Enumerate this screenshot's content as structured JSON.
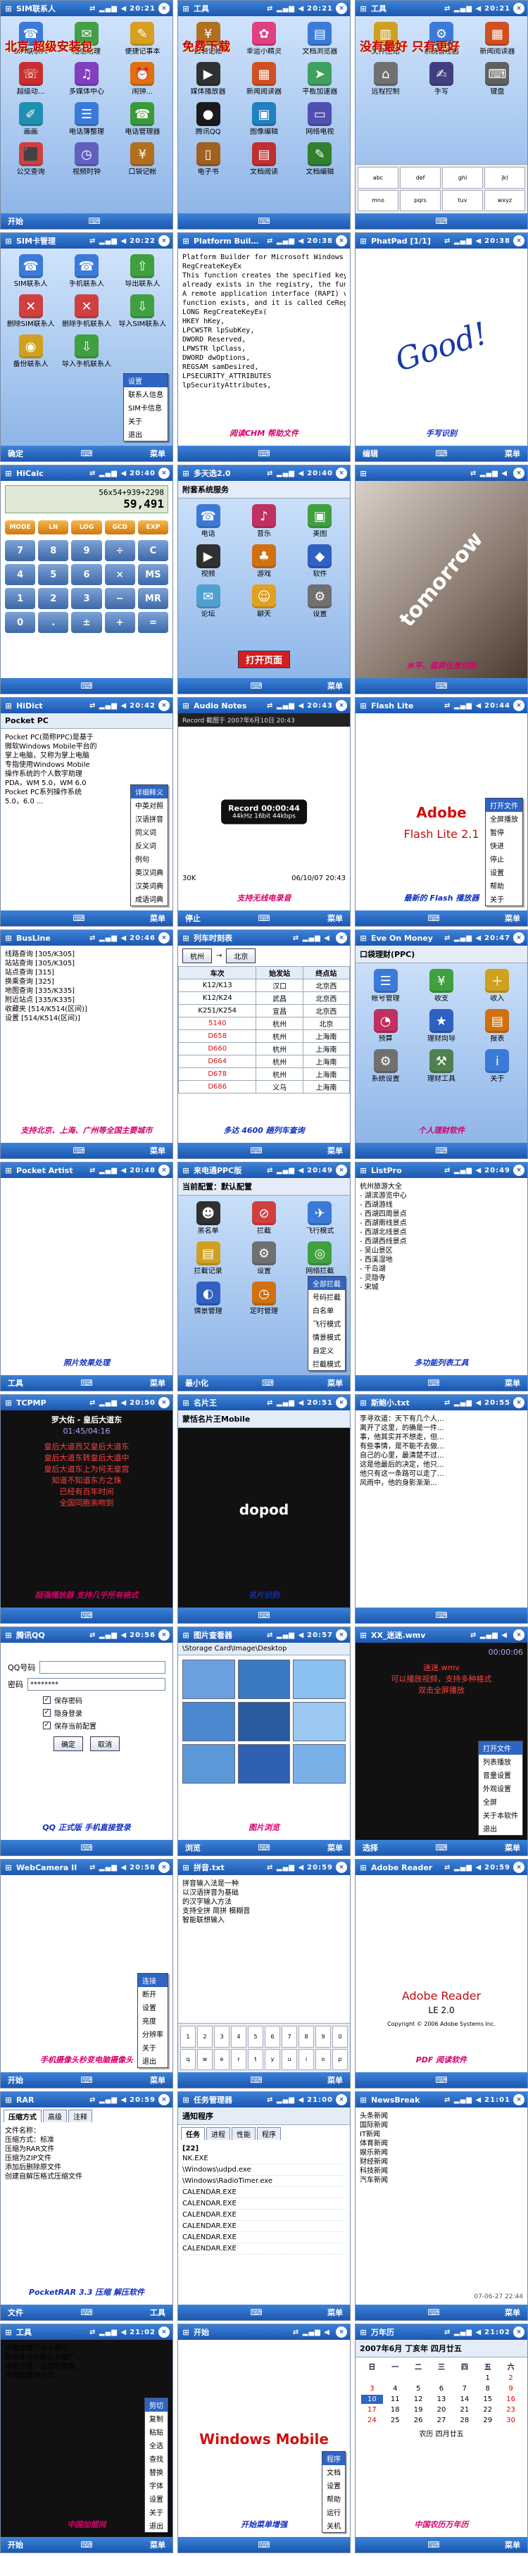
{
  "colors": {
    "titlebar_top": "#3d82d8",
    "titlebar_bottom": "#1c57b0",
    "accent_red": "#c40010",
    "accent_pink": "#d6006b",
    "selection_blue": "#2f64c2"
  },
  "screens": [
    {
      "title": "SIM联系人",
      "time": "20:21",
      "banner": "北京 超级安装包",
      "icons": [
        {
          "label": "SIM联系人",
          "icon": "contacts-icon",
          "color": "#3b7ad8"
        },
        {
          "label": "短信助理",
          "icon": "sms-icon",
          "color": "#44a044"
        },
        {
          "label": "便捷记事本",
          "icon": "note-icon",
          "color": "#d8a020"
        },
        {
          "label": "超级动...",
          "icon": "dial-icon",
          "color": "#c83030"
        },
        {
          "label": "多媒体中心",
          "icon": "media-icon",
          "color": "#8040c0"
        },
        {
          "label": "闹钟...",
          "icon": "alarm-icon",
          "color": "#e07010"
        },
        {
          "label": "画画",
          "icon": "paint-icon",
          "color": "#2090b0"
        },
        {
          "label": "电话簿整理",
          "icon": "phonebook-icon",
          "color": "#3b7ad8"
        },
        {
          "label": "电话管理器",
          "icon": "phone-icon",
          "color": "#3a9a3a"
        },
        {
          "label": "公交查询",
          "icon": "bus-icon",
          "color": "#d04040"
        },
        {
          "label": "视频时钟",
          "icon": "clock-icon",
          "color": "#6060c0"
        },
        {
          "label": "口袋记帐",
          "icon": "wallet-icon",
          "color": "#b07020"
        }
      ],
      "menu_left": "开始",
      "menu_right": ""
    },
    {
      "title": "工具",
      "time": "20:21",
      "banner": "免费下载",
      "icons": [
        {
          "label": "口袋记帐",
          "icon": "wallet-icon",
          "color": "#b07020"
        },
        {
          "label": "幸运小精灵",
          "icon": "luck-icon",
          "color": "#e04080"
        },
        {
          "label": "文档浏览器",
          "icon": "doc-icon",
          "color": "#3b7ad8"
        },
        {
          "label": "媒体播放器",
          "icon": "player-icon",
          "color": "#303030"
        },
        {
          "label": "新闻阅读器",
          "icon": "news-icon",
          "color": "#d05020"
        },
        {
          "label": "平板加速器",
          "icon": "speed-icon",
          "color": "#40a060"
        },
        {
          "label": "腾讯QQ",
          "icon": "qq-icon",
          "color": "#1a1a1a"
        },
        {
          "label": "图像编辑",
          "icon": "image-icon",
          "color": "#2080c0"
        },
        {
          "label": "网络电视",
          "icon": "tv-icon",
          "color": "#5050b0"
        },
        {
          "label": "电子书",
          "icon": "book-icon",
          "color": "#a06020"
        },
        {
          "label": "文档阅读",
          "icon": "reader-icon",
          "color": "#c03030"
        },
        {
          "label": "文档编辑",
          "icon": "edit-icon",
          "color": "#308030"
        }
      ],
      "menu_left": "",
      "menu_right": ""
    },
    {
      "title": "工具",
      "time": "20:21",
      "banner": "没有最好 只有更好",
      "icons": [
        {
          "label": "文件压缩",
          "icon": "zip-icon",
          "color": "#d0a020"
        },
        {
          "label": "系统管理器",
          "icon": "system-icon",
          "color": "#3b7ad8"
        },
        {
          "label": "新闻阅读器",
          "icon": "news-icon",
          "color": "#d05020"
        },
        {
          "label": "远程控制",
          "icon": "remote-icon",
          "color": "#707070"
        },
        {
          "label": "手写",
          "icon": "pen-icon",
          "color": "#404080"
        },
        {
          "label": "键盘",
          "icon": "keyboard-icon",
          "color": "#606060"
        }
      ],
      "keys": [
        "abc",
        "def",
        "ghi",
        "jkl",
        "mno",
        "pqrs",
        "tuv",
        "wxyz"
      ],
      "menu_left": "",
      "menu_right": ""
    },
    {
      "title": "SIM卡管理",
      "time": "20:22",
      "icons": [
        {
          "label": "SIM联系人",
          "icon": "contacts-icon",
          "color": "#3b7ad8"
        },
        {
          "label": "手机联系人",
          "icon": "contacts-icon",
          "color": "#3b7ad8"
        },
        {
          "label": "导出联系人",
          "icon": "export-icon",
          "color": "#40a040"
        },
        {
          "label": "删除SIM联系人",
          "icon": "delete-icon",
          "color": "#d04040"
        },
        {
          "label": "删除手机联系人",
          "icon": "delete-icon",
          "color": "#d04040"
        },
        {
          "label": "导入SIM联系人",
          "icon": "import-icon",
          "color": "#40a040"
        },
        {
          "label": "备份联系人",
          "icon": "backup-icon",
          "color": "#d0a020"
        },
        {
          "label": "导入手机联系人",
          "icon": "import-icon",
          "color": "#40a040"
        }
      ],
      "popup": [
        "设置",
        "联系人信息",
        "SIM卡信息",
        "关于",
        "退出"
      ],
      "menu_left": "确定",
      "menu_right": "菜单"
    },
    {
      "title": "Platform Builder",
      "time": "20:38",
      "banner": "Platform Builder for Microsoft Windows CE 5.0",
      "lines": [
        "Platform Builder for Microsoft Windows CE 5.0",
        "RegCreateKeyEx",
        "This function creates the specified key. If the key",
        "already exists in the registry, the function opens it.",
        "A remote application interface (RAPI) version of this",
        "function exists, and it is called CeRegCreateKeyEx.",
        "LONG RegCreateKeyEx(",
        "  HKEY hKey,",
        "  LPCWSTR lpSubKey,",
        "  DWORD Reserved,",
        "  LPWSTR lpClass,",
        "  DWORD dwOptions,",
        "  REGSAM samDesired,",
        "  LPSECURITY_ATTRIBUTES",
        "  lpSecurityAttributes,"
      ],
      "caption": "阅读CHM 帮助文件",
      "menu_left": "",
      "menu_right": ""
    },
    {
      "title": "PhatPad [1/1]",
      "time": "20:38",
      "handwriting": "Good!",
      "caption": "手写识别",
      "menu_left": "编辑",
      "menu_right": "菜单"
    },
    {
      "title": "HiCalc",
      "time": "20:40",
      "expression": "56x54+939+2298",
      "result": "59,491",
      "func_keys": [
        "MODE",
        "LN",
        "LOG",
        "GCD",
        "EXP"
      ],
      "keys": [
        "7",
        "8",
        "9",
        "÷",
        "C",
        "4",
        "5",
        "6",
        "×",
        "MS",
        "1",
        "2",
        "3",
        "−",
        "MR",
        "0",
        ".",
        "±",
        "+",
        "="
      ],
      "menu_left": "",
      "menu_right": ""
    },
    {
      "title": "多天选2.0",
      "time": "20:40",
      "header": "附套系统服务",
      "icons": [
        {
          "label": "电话",
          "icon": "phone-icon",
          "color": "#3b7ad8"
        },
        {
          "label": "音乐",
          "icon": "music-icon",
          "color": "#c03060"
        },
        {
          "label": "美图",
          "icon": "photo-icon",
          "color": "#40a040"
        },
        {
          "label": "视频",
          "icon": "video-icon",
          "color": "#303030"
        },
        {
          "label": "游戏",
          "icon": "game-icon",
          "color": "#d07010"
        },
        {
          "label": "软件",
          "icon": "software-icon",
          "color": "#3060c0"
        },
        {
          "label": "论坛",
          "icon": "forum-icon",
          "color": "#50a0d0"
        },
        {
          "label": "聊天",
          "icon": "chat-icon",
          "color": "#e0a020"
        },
        {
          "label": "设置",
          "icon": "settings-icon",
          "color": "#707070"
        }
      ],
      "button": "打开页面",
      "menu_left": "",
      "menu_right": "菜单"
    },
    {
      "title": "",
      "time": "",
      "photo_text": "tomorrow",
      "caption": "水平、竖屏任意切换",
      "menu_left": "",
      "menu_right": ""
    },
    {
      "title": "HiDict",
      "time": "20:42",
      "header": "Pocket PC",
      "lines": [
        "Pocket PC(简称PPC)是基于",
        "微软Windows Mobile平台的",
        "掌上电脑，又称为掌上电脑",
        "专指使用Windows Mobile",
        "操作系统的个人数字助理",
        "PDA，WM 5.0，WM 6.0",
        "Pocket PC系列操作系统",
        "5.0，6.0 ..."
      ],
      "popup": [
        "详细释义",
        "中英对照",
        "汉语拼音",
        "同义词",
        "反义词",
        "例句",
        "英汉词典",
        "汉英词典",
        "成语词典"
      ],
      "menu_left": "",
      "menu_right": "菜单"
    },
    {
      "title": "Audio Notes",
      "time": "20:43",
      "status": "Record 截图于 2007年6月10日 20:43",
      "caption": "支持无线电录音",
      "record_text": "Record 00:00:44",
      "format_text": "44kHz 16bit 44kbps",
      "footer_left": "30K",
      "footer_right": "06/10/07 20:43",
      "menu_left": "停止",
      "menu_right": "菜单"
    },
    {
      "title": "Flash Lite",
      "time": "20:44",
      "caption": "最新的 Flash 播放器",
      "brand": "Adobe",
      "product": "Flash Lite 2.1",
      "popup": [
        "打开文件",
        "全屏播放",
        "暂停",
        "快进",
        "停止",
        "设置",
        "帮助",
        "关于"
      ],
      "menu_left": "",
      "menu_right": "菜单"
    },
    {
      "title": "BusLine",
      "time": "20:46",
      "lines": [
        "线路查询 [305/K305]",
        "站站查询 [305/K305]",
        "站点查询 [315]",
        "换乘查询 [325]",
        "地图查询 [335/K335]",
        "附近站点 [335/K335]",
        "收藏夹 [514/K514(区间)]",
        "设置 [514/K514(区间)]"
      ],
      "caption": "支持北京、上海、广州等全国主要城市",
      "menu_left": "",
      "menu_right": "菜单"
    },
    {
      "title": "列车时刻表",
      "time": "",
      "from": "杭州",
      "to": "北京",
      "columns": [
        "车次",
        "始发站",
        "终点站"
      ],
      "rows": [
        [
          "K12/K13",
          "汉口",
          "北京西"
        ],
        [
          "K12/K24",
          "武昌",
          "北京西"
        ],
        [
          "K251/K254",
          "宣昌",
          "北京西"
        ],
        [
          "5140",
          "杭州",
          "北京"
        ],
        [
          "D658",
          "杭州",
          "上海南"
        ],
        [
          "D660",
          "杭州",
          "上海南"
        ],
        [
          "D664",
          "杭州",
          "上海南"
        ],
        [
          "D678",
          "杭州",
          "上海南"
        ],
        [
          "D686",
          "义乌",
          "上海南"
        ]
      ],
      "caption": "多达 4600 趟列车查询",
      "menu_left": "",
      "menu_right": "菜单"
    },
    {
      "title": "Eve On Money",
      "time": "20:47",
      "header": "口袋理财(PPC)",
      "icons": [
        {
          "label": "帐号管理",
          "icon": "account-icon",
          "color": "#3b7ad8"
        },
        {
          "label": "收支",
          "icon": "money-icon",
          "color": "#40a040"
        },
        {
          "label": "收入",
          "icon": "income-icon",
          "color": "#d0a020"
        },
        {
          "label": "预算",
          "icon": "budget-icon",
          "color": "#c03060"
        },
        {
          "label": "理财向导",
          "icon": "guide-icon",
          "color": "#3060c0"
        },
        {
          "label": "报表",
          "icon": "report-icon",
          "color": "#d07010"
        },
        {
          "label": "系统设置",
          "icon": "settings-icon",
          "color": "#707070"
        },
        {
          "label": "理财工具",
          "icon": "tools-icon",
          "color": "#508050"
        },
        {
          "label": "关于",
          "icon": "info-icon",
          "color": "#3b7ad8"
        }
      ],
      "caption": "个人理财软件",
      "menu_left": "",
      "menu_right": ""
    },
    {
      "title": "Pocket Artist",
      "time": "20:48",
      "caption": "照片效果处理",
      "menu_left": "工具",
      "menu_right": "菜单"
    },
    {
      "title": "来电通PPC版",
      "time": "20:49",
      "header": "当前配置：默认配置",
      "icons": [
        {
          "label": "黑名单",
          "icon": "blacklist-icon",
          "color": "#303030"
        },
        {
          "label": "拦截",
          "icon": "block-icon",
          "color": "#d04040"
        },
        {
          "label": "飞行模式",
          "icon": "plane-icon",
          "color": "#3b7ad8"
        },
        {
          "label": "拦截记录",
          "icon": "log-icon",
          "color": "#d0a020"
        },
        {
          "label": "设置",
          "icon": "settings-icon",
          "color": "#707070"
        },
        {
          "label": "网络拦截",
          "icon": "network-icon",
          "color": "#40a040"
        },
        {
          "label": "情景管理",
          "icon": "scene-icon",
          "color": "#3060c0"
        },
        {
          "label": "定时管理",
          "icon": "timer-icon",
          "color": "#d07010"
        },
        {
          "label": "数据库",
          "icon": "database-icon",
          "color": "#8040c0"
        }
      ],
      "popup": [
        "全部拦截",
        "号码拦截",
        "白名单",
        "飞行模式",
        "情景模式",
        "自定义",
        "拦截模式"
      ],
      "menu_left": "最小化",
      "menu_right": "菜单"
    },
    {
      "title": "ListPro",
      "time": "20:49",
      "lines": [
        "杭州旅游大全",
        "- 湖滨游览中心",
        "- 西湖游线",
        "- 西湖四周景点",
        "- 西湖南线景点",
        "- 西湖北线景点",
        "- 西湖西线景点",
        "- 吴山景区",
        "- 西溪湿地",
        "- 千岛湖",
        "- 灵隐寺",
        "- 宋城"
      ],
      "caption": "多功能列表工具",
      "menu_left": "",
      "menu_right": "菜单"
    },
    {
      "title": "TCPMP",
      "time": "20:50",
      "song": "罗大佑 - 皇后大道东",
      "duration": "01:45/04:16",
      "lyrics": [
        "皇后大道西又皇后大道东",
        "皇后大道东转皇后大道中",
        "皇后大道东上为何无皇宫",
        "知道不知道东方之珠",
        "已经有百年时间",
        "全国同胞亲吻到"
      ],
      "caption": "超强播放器 支持几乎所有格式",
      "menu_left": "",
      "menu_right": ""
    },
    {
      "title": "名片王",
      "time": "20:51",
      "header": "蒙恬名片王Mobile",
      "caption": "名片识别",
      "brand": "dopod",
      "menu_left": "",
      "menu_right": ""
    },
    {
      "title": "斯鲍小.txt",
      "time": "20:55",
      "lines": [
        "李寻欢道：天下有几个人...",
        "离开了这里，的确是一件...",
        "事，他其实并不想走，但...",
        "有些事情，是不能不去做...",
        "自己的心里，最清楚不过...",
        "这是他最后的决定，他只...",
        "他只有这一条路可以走了...",
        "风雨中，他的身影渐渐..."
      ],
      "status": "27%  斯鲍小.txt  2007/6/9 19:29:1%  20:55",
      "menu_left": "",
      "menu_right": ""
    },
    {
      "title": "腾讯QQ",
      "time": "20:56",
      "qq_label": "QQ号码",
      "qq_value": "",
      "password_label": "密码",
      "password_value": "********",
      "checks": [
        {
          "label": "保存密码",
          "checked": true
        },
        {
          "label": "隐身登录",
          "checked": true
        },
        {
          "label": "保存当前配置",
          "checked": true
        }
      ],
      "ok_label": "确定",
      "cancel_label": "取消",
      "caption": "QQ 正式版 手机直接登录",
      "menu_left": "",
      "menu_right": ""
    },
    {
      "title": "图片查看器",
      "time": "20:57",
      "path": "\\Storage Card\\Image\\Desktop",
      "caption": "图片浏览",
      "menu_left": "浏览",
      "menu_right": "菜单"
    },
    {
      "title": "XX_迷迷.wmv",
      "time": "",
      "duration": "00:00:06",
      "lyrics": [
        "迷迷.wmv",
        "可以播放视频，支持多种格式",
        "双击全屏播放"
      ],
      "popup": [
        "打开文件",
        "列表播放",
        "音量设置",
        "外观设置",
        "全屏",
        "关于本软件",
        "退出"
      ],
      "menu_left": "选择",
      "menu_right": "菜单"
    },
    {
      "title": "WebCamera II",
      "time": "20:58",
      "caption": "手机摄像头秒变电脑摄像头",
      "popup": [
        "连接",
        "断开",
        "设置",
        "亮度",
        "分辨率",
        "关于",
        "退出"
      ],
      "menu_left": "开始",
      "menu_right": "菜单"
    },
    {
      "title": "拼音.txt",
      "time": "20:59",
      "lines": [
        "拼音输入法是一种",
        "以汉语拼音为基础",
        "的汉字输入方法",
        "支持全拼 简拼 模糊音",
        "智能联想输入"
      ],
      "keys": [
        "1",
        "2",
        "3",
        "4",
        "5",
        "6",
        "7",
        "8",
        "9",
        "0",
        "q",
        "w",
        "e",
        "r",
        "t",
        "y",
        "u",
        "i",
        "o",
        "p"
      ],
      "menu_left": "",
      "menu_right": "菜单"
    },
    {
      "title": "Adobe Reader",
      "time": "20:59",
      "caption": "PDF 阅读软件",
      "product": "Adobe Reader",
      "version": "LE 2.0",
      "copyright": "Copyright © 2006 Adobe Systems Inc.",
      "menu_left": "",
      "menu_right": ""
    },
    {
      "title": "RAR",
      "time": "20:59",
      "tabs": [
        "压缩方式",
        "高级",
        "注释"
      ],
      "lines": [
        "文件名称：",
        "压缩方式：标准",
        "压缩为RAR文件",
        "压缩为ZIP文件",
        "添加后删除原文件",
        "创建自解压格式压缩文件"
      ],
      "caption": "PocketRAR 3.3 压缩 解压软件",
      "menu_left": "文件",
      "menu_right": "工具"
    },
    {
      "title": "任务管理器",
      "time": "21:00",
      "tabs": [
        "任务",
        "进程",
        "性能",
        "程序"
      ],
      "header": "通知程序",
      "count": "[22]",
      "processes": [
        "NK.EXE",
        "\\Windows\\udpd.exe",
        "\\Windows\\RadioTimer.exe",
        "CALENDAR.EXE",
        "CALENDAR.EXE",
        "CALENDAR.EXE",
        "CALENDAR.EXE",
        "CALENDAR.EXE",
        "CALENDAR.EXE"
      ],
      "menu_left": "",
      "menu_right": "菜单"
    },
    {
      "title": "NewsBreak",
      "time": "21:01",
      "lines": [
        "头条新闻",
        "国际新闻",
        "IT新闻",
        "体育新闻",
        "娱乐新闻",
        "财经新闻",
        "科技新闻",
        "汽车新闻"
      ],
      "date": "07-06-27 22:44",
      "menu_left": "",
      "menu_right": "菜单"
    },
    {
      "title": "工具",
      "time": "21:02",
      "lines": [
        "中国加盟行业大都与...",
        "提供多元化的企业推广...",
        "商机无限，让您的财富...",
        "中国加盟网为您..."
      ],
      "popup": [
        "剪切",
        "复制",
        "粘贴",
        "全选",
        "查找",
        "替换",
        "字体",
        "设置",
        "关于",
        "退出"
      ],
      "caption": "中国加盟网",
      "menu_left": "开始",
      "menu_right": "菜单"
    },
    {
      "title": "开始",
      "time": "",
      "popup": [
        "程序",
        "文档",
        "设置",
        "帮助",
        "运行",
        "关机"
      ],
      "brand": "Windows Mobile",
      "edition": "Enterprise Edition",
      "caption": "开始菜单增强",
      "menu_left": "",
      "menu_right": ""
    },
    {
      "title": "万年历",
      "time": "21:02",
      "header": "2007年6月 丁亥年 四月廿五",
      "subheader": "农历 四月廿五",
      "days_header": [
        "日",
        "一",
        "二",
        "三",
        "四",
        "五",
        "六"
      ],
      "days": [
        "",
        "",
        "",
        "",
        "",
        "1",
        "2",
        "3",
        "4",
        "5",
        "6",
        "7",
        "8",
        "9",
        "10",
        "11",
        "12",
        "13",
        "14",
        "15",
        "16",
        "17",
        "18",
        "19",
        "20",
        "21",
        "22",
        "23",
        "24",
        "25",
        "26",
        "27",
        "28",
        "29",
        "30"
      ],
      "today": "10",
      "caption": "中国农历万年历",
      "menu_left": "",
      "menu_right": "菜单"
    }
  ]
}
